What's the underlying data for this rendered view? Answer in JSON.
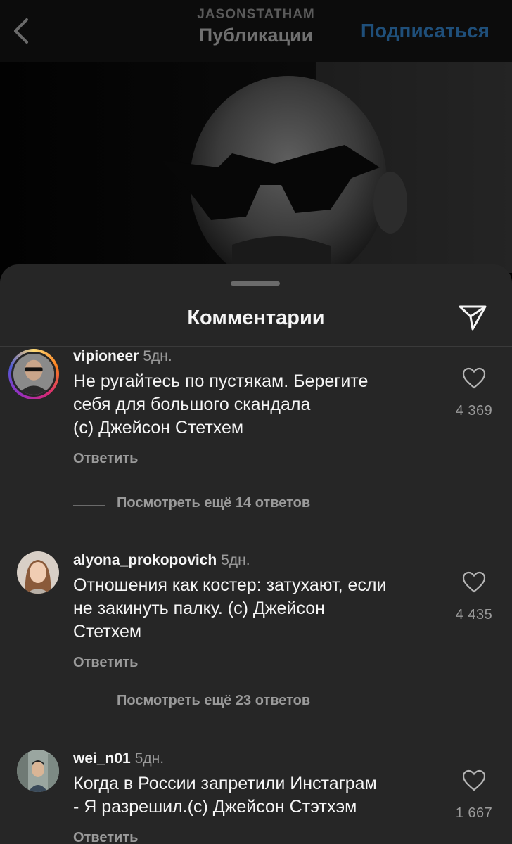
{
  "header": {
    "username": "JASONSTATHAM",
    "title": "Публикации",
    "follow_label": "Подписаться"
  },
  "sheet": {
    "title": "Комментарии"
  },
  "comments": [
    {
      "user": "vipioneer",
      "time": "5дн.",
      "lines": [
        "Не ругайтесь по пустякам. Берегите",
        "себя для большого скандала",
        "(c) Джейсон Стетхем"
      ],
      "reply_label": "Ответить",
      "likes": "4 369",
      "more_replies": "Посмотреть ещё 14 ответов"
    },
    {
      "user": "alyona_prokopovich",
      "time": "5дн.",
      "lines": [
        "Отношения как костер: затухают, если",
        "не закинуть палку. (с) Джейсон",
        "Стетхем"
      ],
      "reply_label": "Ответить",
      "likes": "4 435",
      "more_replies": "Посмотреть ещё 23 ответов"
    },
    {
      "user": "wei_n01",
      "time": "5дн.",
      "lines": [
        "Когда в России запретили Инстаграм",
        "- Я разрешил.(с) Джейсон Стэтхэм"
      ],
      "reply_label": "Ответить",
      "likes": "1 667"
    }
  ],
  "colors": {
    "follow": "#1f4f7a",
    "sheet_bg": "#262626",
    "muted_text": "#9a9a9a"
  },
  "icons": {
    "back": "chevron-left-icon",
    "share": "paper-plane-icon",
    "like": "heart-icon"
  }
}
